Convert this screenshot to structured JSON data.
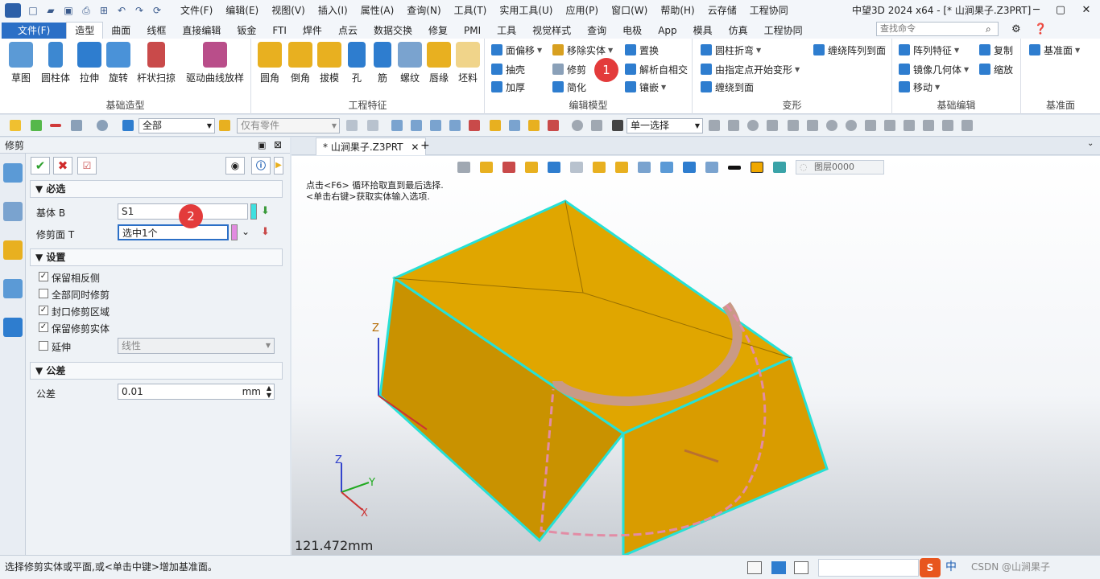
{
  "title_bar": {
    "quick_access_icons": [
      "new-file-icon",
      "open-folder-icon",
      "save-icon",
      "print-icon",
      "print-preview-icon",
      "undo-icon",
      "redo-icon",
      "rotate-icon"
    ],
    "menus": [
      "文件(F)",
      "编辑(E)",
      "视图(V)",
      "插入(I)",
      "属性(A)",
      "查询(N)",
      "工具(T)",
      "实用工具(U)",
      "应用(P)",
      "窗口(W)",
      "帮助(H)",
      "云存储",
      "工程协同"
    ],
    "window_title": "中望3D 2024 x64 - [* 山涧果子.Z3PRT]"
  },
  "ribbon_tabs": [
    "文件(F)",
    "造型",
    "曲面",
    "线框",
    "直接编辑",
    "钣金",
    "FTI",
    "焊件",
    "点云",
    "数据交换",
    "修复",
    "PMI",
    "工具",
    "视觉样式",
    "查询",
    "电极",
    "App",
    "模具",
    "仿真",
    "工程协同"
  ],
  "active_tab": "造型",
  "command_search": {
    "placeholder": "查找命令"
  },
  "ribbon": {
    "basic_modeling": {
      "label": "基础造型",
      "buttons": [
        "草图",
        "圆柱体",
        "拉伸",
        "旋转",
        "杆状扫掠",
        "驱动曲线放样"
      ]
    },
    "engineering_features": {
      "label": "工程特征",
      "buttons": [
        "圆角",
        "倒角",
        "拔模",
        "孔",
        "筋",
        "螺纹",
        "唇缘",
        "坯料"
      ]
    },
    "edit_model": {
      "label": "编辑模型",
      "col1": [
        "面偏移",
        "抽壳",
        "加厚"
      ],
      "col2": [
        "移除实体",
        "修剪",
        "简化"
      ],
      "col3": [
        "置换",
        "解析自相交",
        "镶嵌"
      ]
    },
    "deform": {
      "label": "变形",
      "col1": [
        "圆柱折弯",
        "由指定点开始变形",
        "缠绕到面"
      ],
      "col2": [
        "缠绕阵列到面"
      ]
    },
    "basic_edit": {
      "label": "基础编辑",
      "col1": [
        "阵列特征",
        "镜像几何体",
        "移动"
      ],
      "col2": [
        "复制",
        "缩放"
      ]
    },
    "datum": {
      "label": "基准面",
      "buttons": [
        "基准面"
      ]
    }
  },
  "toolbar": {
    "filter_value": "全部",
    "parts_value": "仅有零件",
    "select_mode": "单一选择"
  },
  "panel": {
    "title": "修剪",
    "required_section": "必选",
    "base_label": "基体 B",
    "base_value": "S1",
    "trim_face_label": "修剪面 T",
    "trim_face_value": "选中1个",
    "settings_section": "设置",
    "options": [
      {
        "label": "保留相反侧",
        "checked": true
      },
      {
        "label": "全部同时修剪",
        "checked": false
      },
      {
        "label": "封口修剪区域",
        "checked": true
      },
      {
        "label": "保留修剪实体",
        "checked": true
      }
    ],
    "extend_label": "延伸",
    "extend_checked": false,
    "extend_mode": "线性",
    "tolerance_section": "公差",
    "tolerance_label": "公差",
    "tolerance_value": "0.01",
    "tolerance_unit": "mm"
  },
  "viewport": {
    "doc_tab": "* 山涧果子.Z3PRT",
    "layer": "图层0000",
    "hint_line1": "点击<F6> 循环拾取直到最后选择.",
    "hint_line2": "<单击右键>获取实体输入选项.",
    "measure": "121.472mm",
    "axis_labels": {
      "x": "X",
      "y": "Y",
      "z": "Z"
    },
    "colors": {
      "solid": "#dba000",
      "edge": "#27e0d6",
      "trim_face": "#e28ca5"
    }
  },
  "callouts": [
    "1",
    "2"
  ],
  "status": {
    "message": "选择修剪实体或平面,或<单击中键>增加基准面。",
    "ime": "中",
    "watermark": "CSDN @山涧果子"
  }
}
